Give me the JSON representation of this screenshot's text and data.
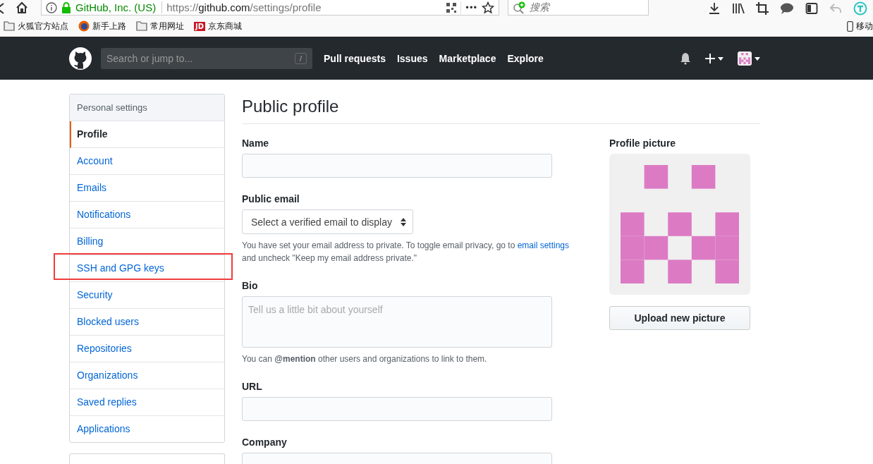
{
  "browser": {
    "identity": "GitHub, Inc. (US)",
    "url_prefix": "https://",
    "url_host": "github.com",
    "url_path": "/settings/profile",
    "more": "•••",
    "search_placeholder": "搜索",
    "bookmarks": [
      {
        "label": "火狐官方站点",
        "kind": "folder"
      },
      {
        "label": "新手上路",
        "kind": "firefox"
      },
      {
        "label": "常用网址",
        "kind": "folder"
      },
      {
        "label": "京东商城",
        "kind": "jd",
        "badge": "JD"
      }
    ],
    "mobile_bookmark": "移动"
  },
  "header": {
    "search_placeholder": "Search or jump to...",
    "slash_key": "/",
    "nav": [
      "Pull requests",
      "Issues",
      "Marketplace",
      "Explore"
    ]
  },
  "sidebar": {
    "title": "Personal settings",
    "items": [
      {
        "label": "Profile",
        "selected": true,
        "annotated": false
      },
      {
        "label": "Account",
        "selected": false,
        "annotated": false
      },
      {
        "label": "Emails",
        "selected": false,
        "annotated": false
      },
      {
        "label": "Notifications",
        "selected": false,
        "annotated": false
      },
      {
        "label": "Billing",
        "selected": false,
        "annotated": false
      },
      {
        "label": "SSH and GPG keys",
        "selected": false,
        "annotated": true
      },
      {
        "label": "Security",
        "selected": false,
        "annotated": false
      },
      {
        "label": "Blocked users",
        "selected": false,
        "annotated": false
      },
      {
        "label": "Repositories",
        "selected": false,
        "annotated": false
      },
      {
        "label": "Organizations",
        "selected": false,
        "annotated": false
      },
      {
        "label": "Saved replies",
        "selected": false,
        "annotated": false
      },
      {
        "label": "Applications",
        "selected": false,
        "annotated": false
      }
    ]
  },
  "main": {
    "title": "Public profile",
    "fields": [
      {
        "kind": "text",
        "label": "Name"
      },
      {
        "kind": "select",
        "label": "Public email",
        "value": "Select a verified email to display",
        "note": {
          "before": "You have set your email address to private. To toggle email privacy, go to ",
          "link": "email settings",
          "after": " and uncheck \"Keep my email address private.\""
        }
      },
      {
        "kind": "textarea",
        "label": "Bio",
        "placeholder": "Tell us a little bit about yourself",
        "note": {
          "before": "You can **@mention** other users and organizations to link to them."
        }
      },
      {
        "kind": "text",
        "label": "URL"
      },
      {
        "kind": "text",
        "label": "Company"
      }
    ]
  },
  "profile_picture": {
    "label": "Profile picture",
    "button": "Upload new picture"
  }
}
